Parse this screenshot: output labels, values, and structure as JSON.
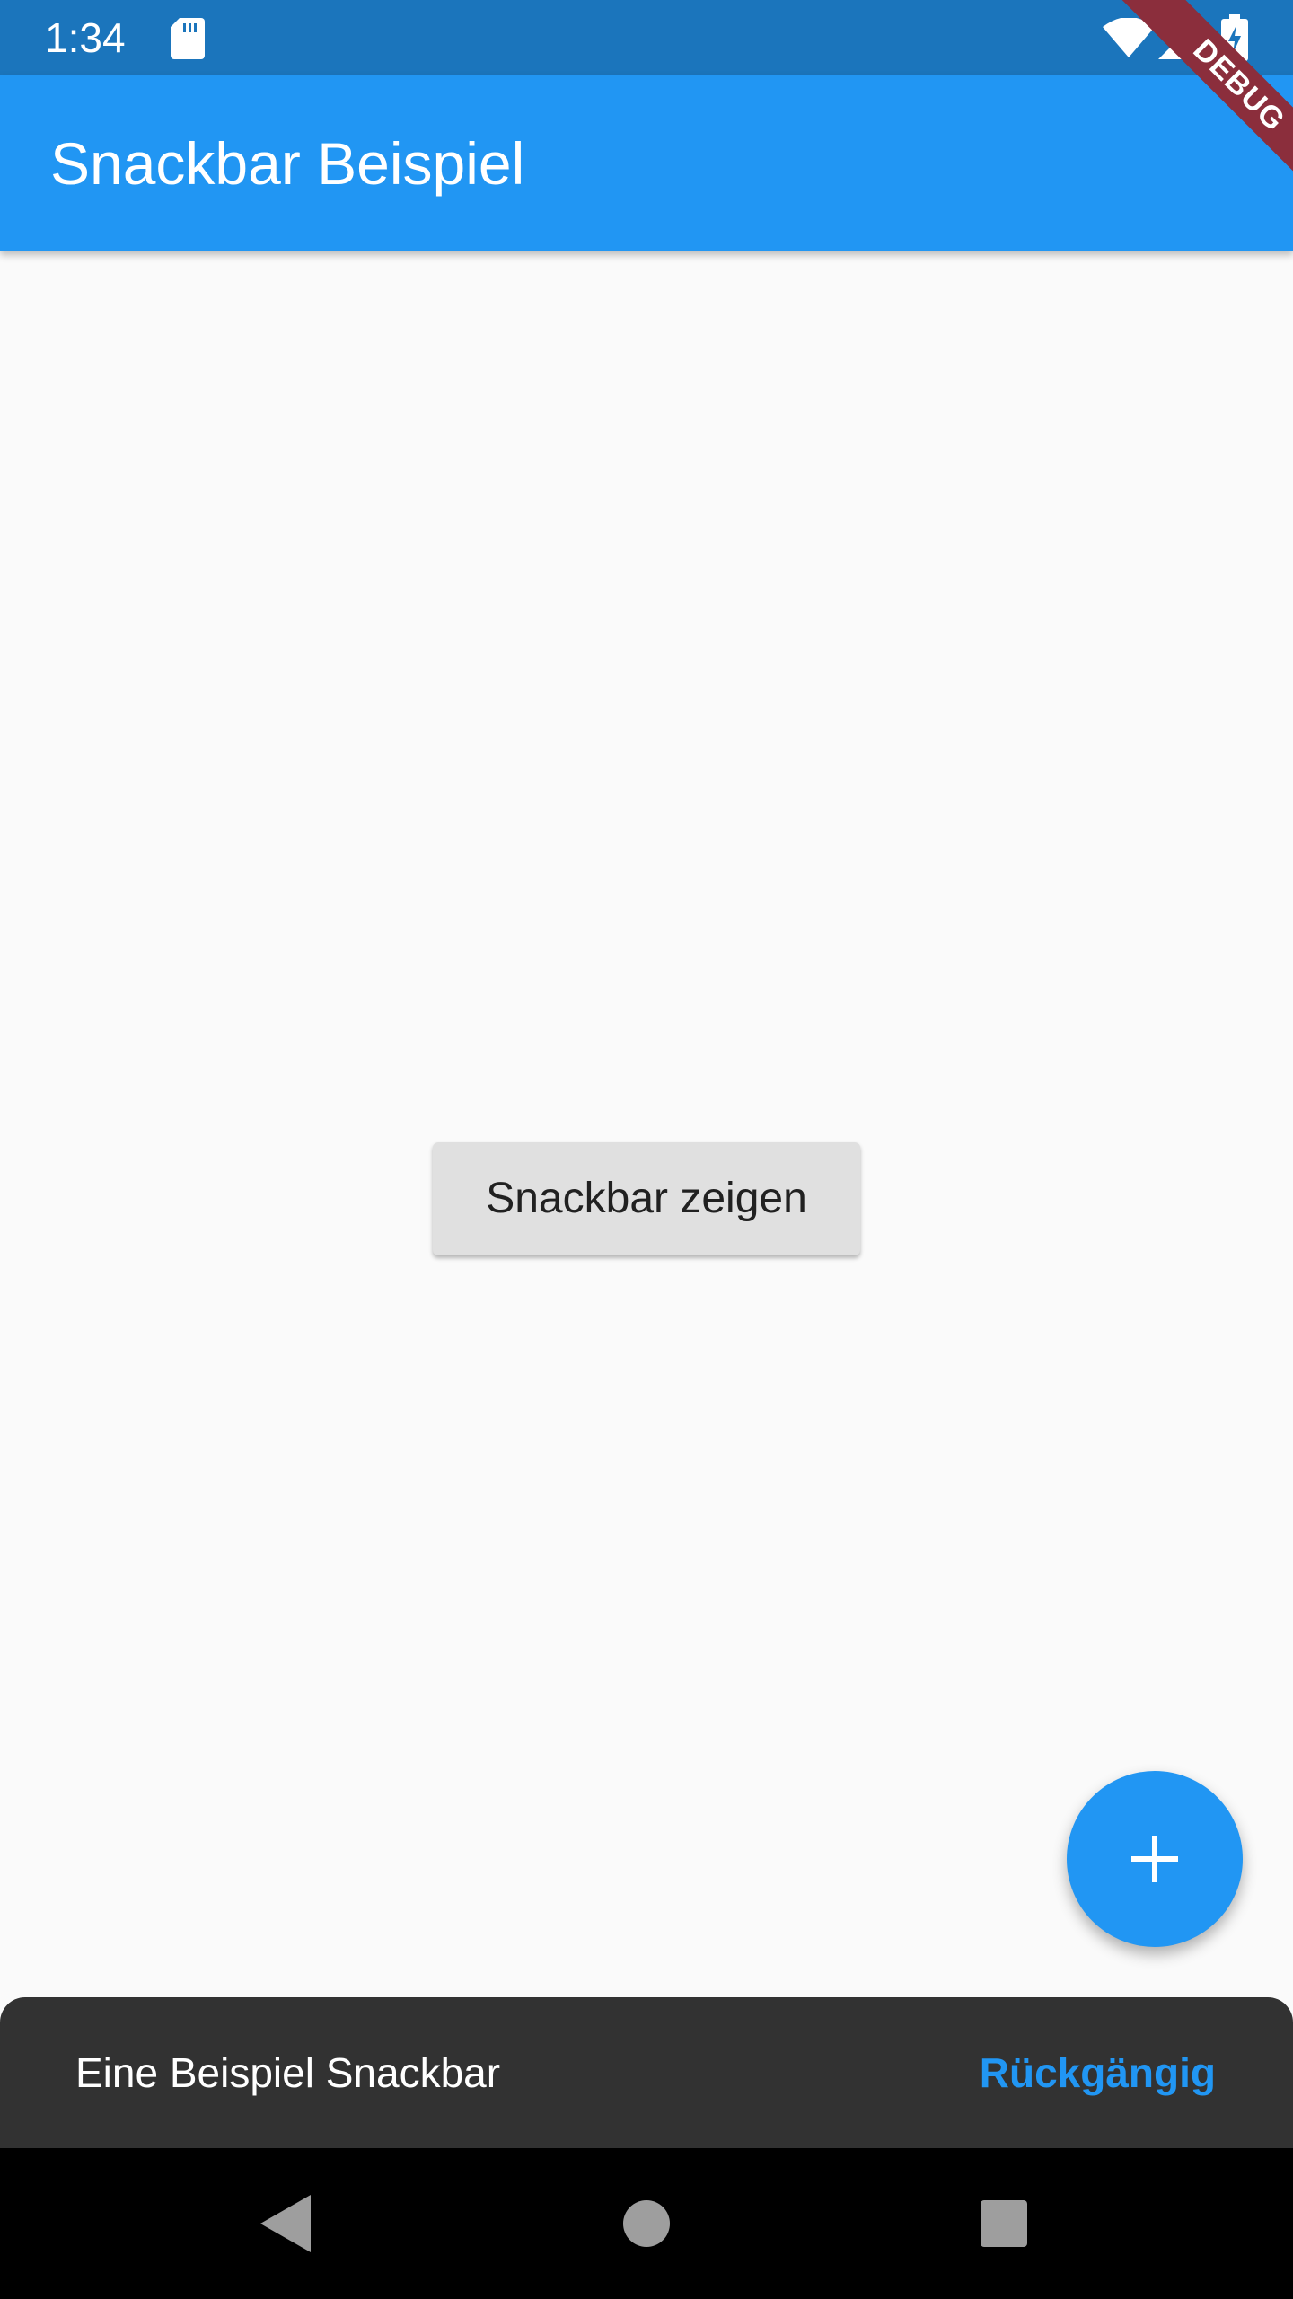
{
  "status_bar": {
    "time": "1:34",
    "icons": [
      "sd-card-icon",
      "wifi-icon",
      "signal-icon",
      "battery-charging-icon"
    ]
  },
  "app_bar": {
    "title": "Snackbar Beispiel"
  },
  "debug_banner": {
    "label": "DEBUG"
  },
  "main": {
    "button_label": "Snackbar zeigen"
  },
  "fab": {
    "icon": "add-icon"
  },
  "snackbar": {
    "message": "Eine Beispiel Snackbar",
    "action_label": "Rückgängig"
  },
  "nav_bar": {
    "icons": [
      "back-icon",
      "home-icon",
      "recents-icon"
    ]
  },
  "colors": {
    "status_bar": "#1b75bc",
    "primary": "#2196f3",
    "background": "#fafafa",
    "button": "#e0e0e0",
    "snackbar": "#323232",
    "debug_banner": "#8b2e3c",
    "nav_bar": "#000000"
  }
}
